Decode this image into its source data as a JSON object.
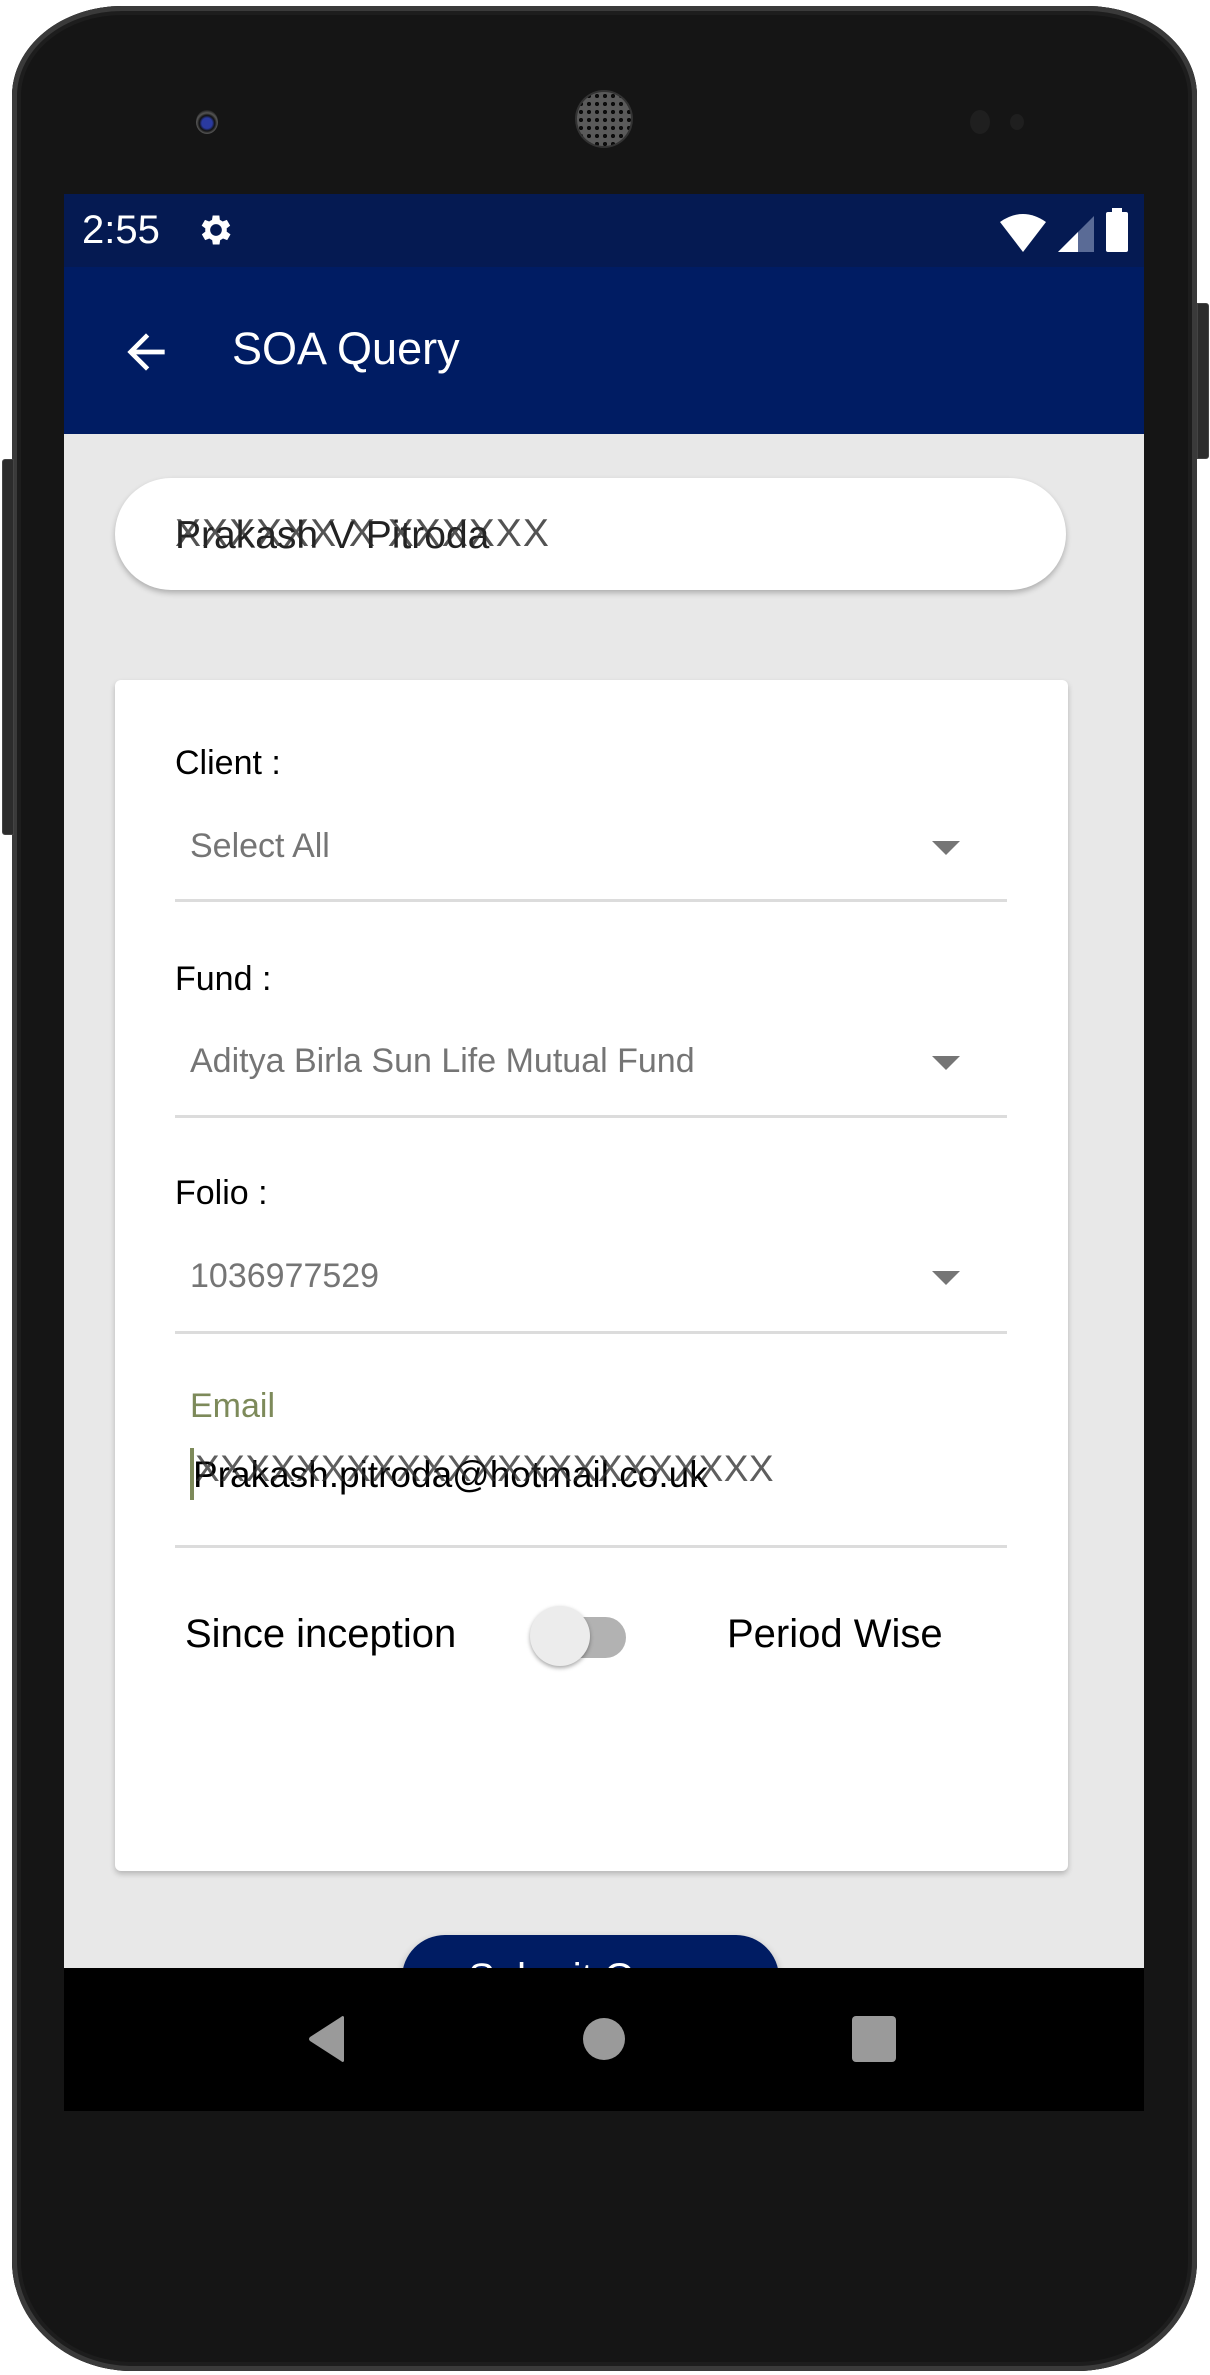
{
  "status_bar": {
    "time": "2:55",
    "icons": [
      "settings-icon",
      "wifi-icon",
      "cellular-signal-icon",
      "battery-icon"
    ]
  },
  "app_bar": {
    "title": "SOA Query",
    "back_icon": "arrow-back-icon"
  },
  "user": {
    "name": "Prakash V Pitroda",
    "name_redaction": "XXXXXX X XXXXXX"
  },
  "form": {
    "client": {
      "label": "Client :",
      "value": "Select All"
    },
    "fund": {
      "label": "Fund :",
      "value": "Aditya Birla Sun Life Mutual Fund"
    },
    "folio": {
      "label": "Folio :",
      "value": "1036977529"
    },
    "email": {
      "label": "Email",
      "value": "Prakash.pitroda@hotmail.co.uk",
      "redaction": "XXXXXXXXXXXXXXXXXXXXXXX"
    },
    "period_toggle": {
      "left_label": "Since inception",
      "right_label": "Period Wise",
      "on": false
    },
    "submit_label": "Submit Query"
  },
  "nav_bar": {
    "buttons": [
      "back",
      "home",
      "recents"
    ]
  },
  "colors": {
    "primary": "#001c63",
    "status_bar": "#051a52",
    "email_accent": "#7d8a5a",
    "background": "#e8e8e8"
  }
}
